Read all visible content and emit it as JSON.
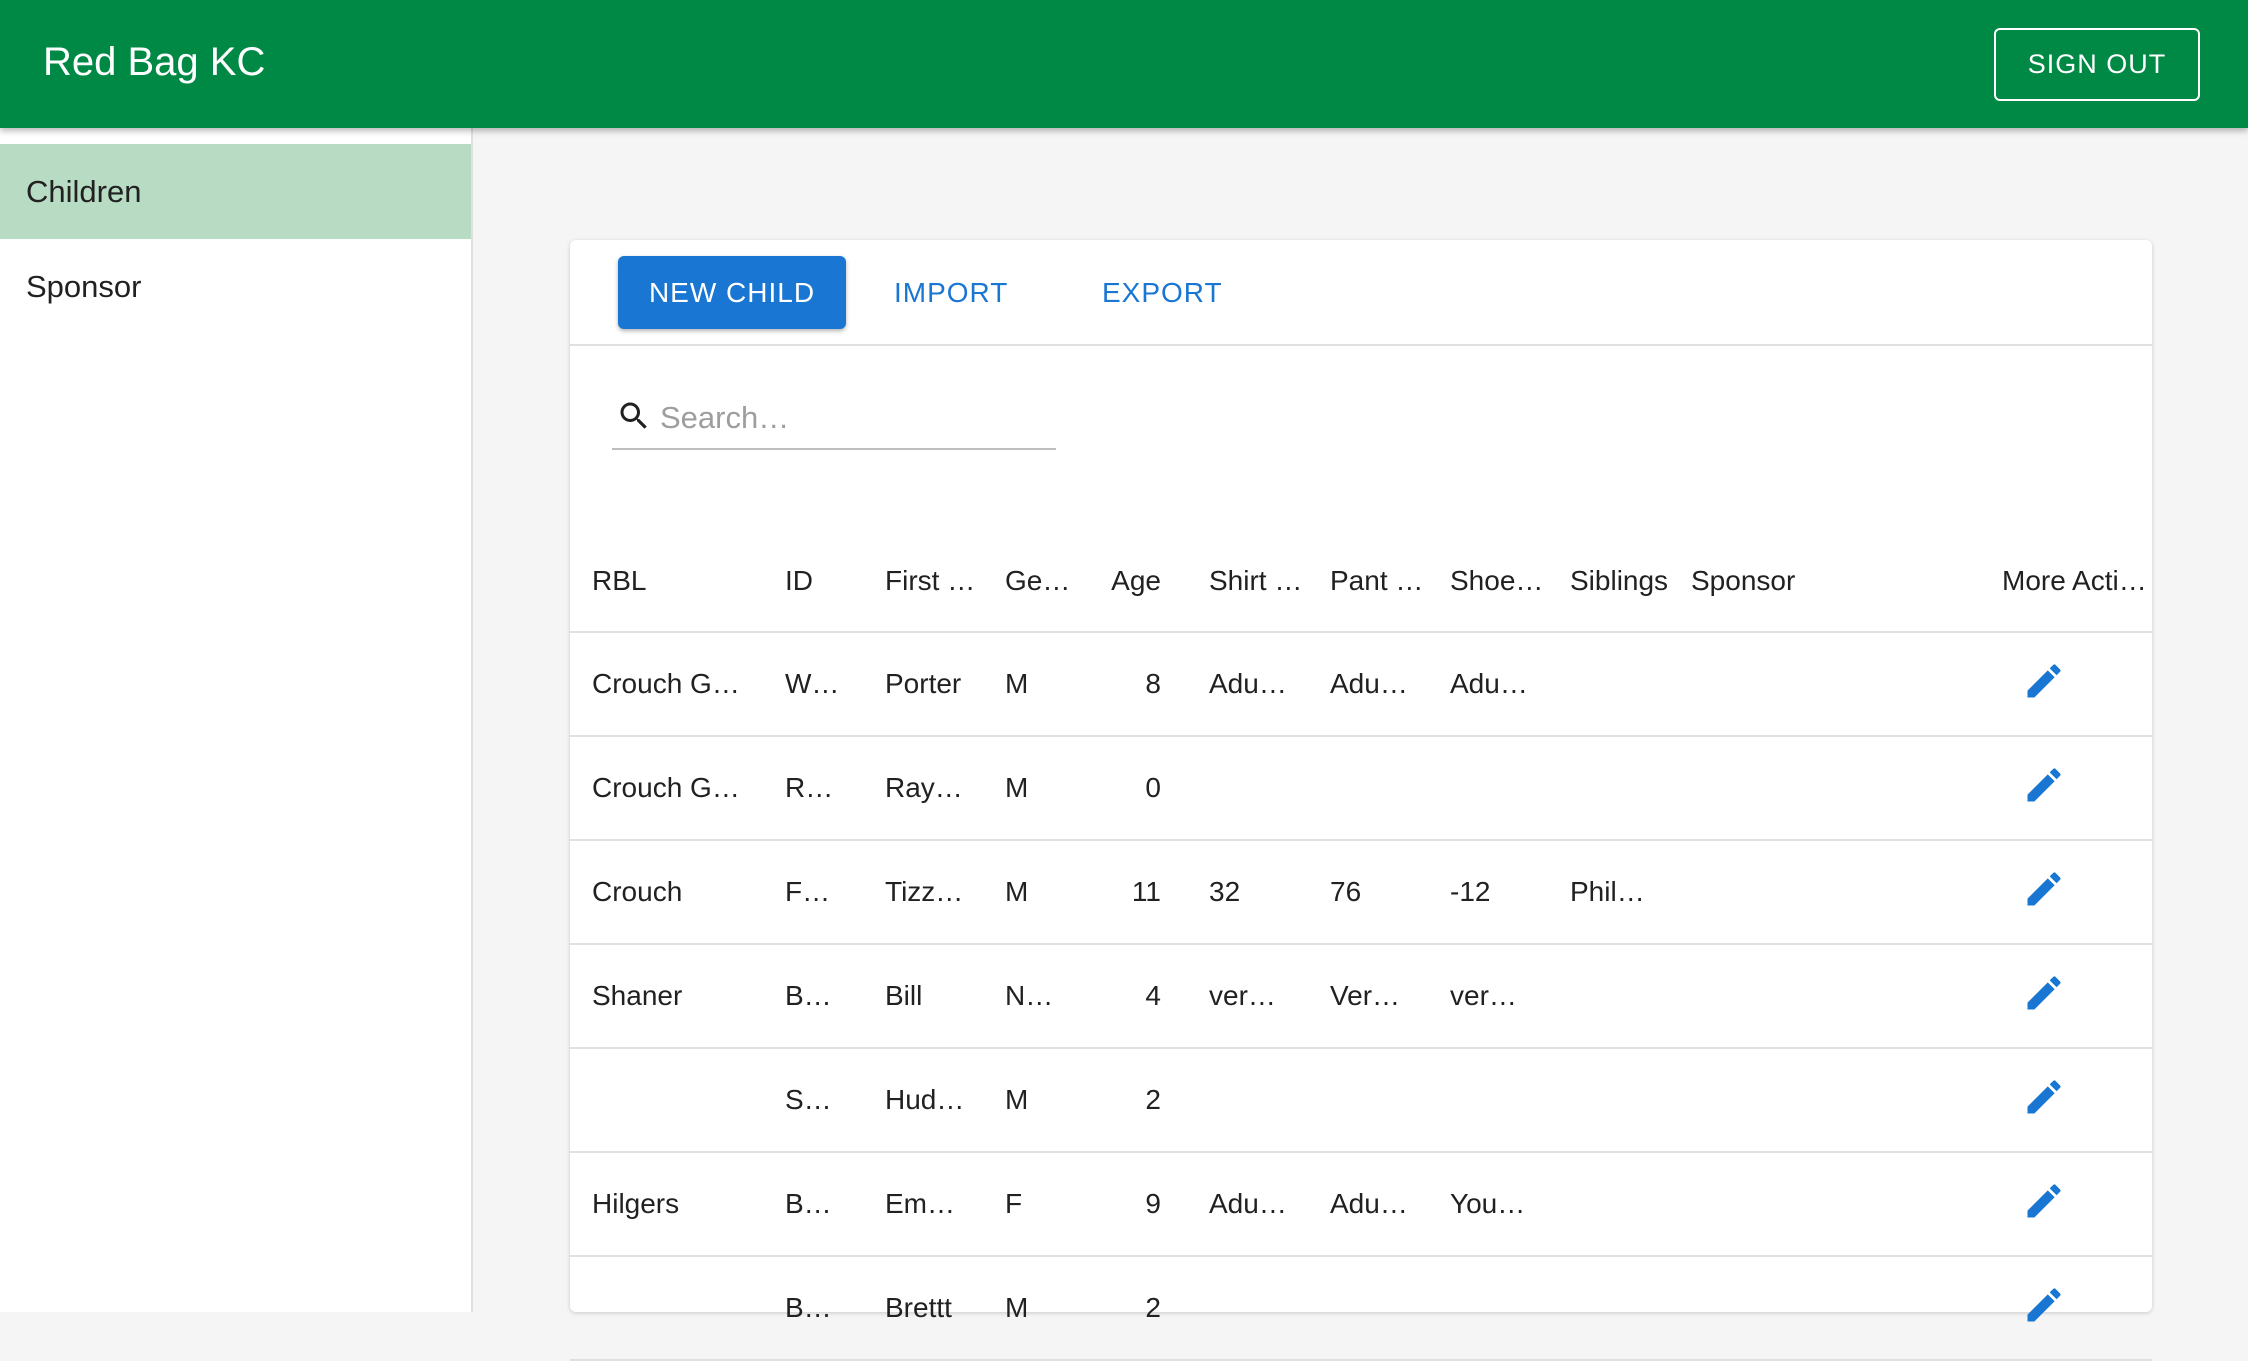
{
  "app": {
    "title": "Red Bag KC",
    "sign_out_label": "SIGN OUT"
  },
  "sidebar": {
    "items": [
      {
        "label": "Children"
      },
      {
        "label": "Sponsor"
      }
    ]
  },
  "toolbar": {
    "new_child_label": "NEW CHILD",
    "import_label": "IMPORT",
    "export_label": "EXPORT"
  },
  "search": {
    "placeholder": "Search…",
    "value": ""
  },
  "table": {
    "headers": [
      "RBL",
      "ID",
      "First …",
      "Ge…",
      "Age",
      "Shirt …",
      "Pant …",
      "Shoe…",
      "Siblings",
      "Sponsor",
      "More Acti…"
    ],
    "rows": [
      [
        "Crouch G…",
        "W…",
        "Porter",
        "M",
        "8",
        "Adu…",
        "Adu…",
        "Adu…",
        "",
        ""
      ],
      [
        "Crouch G…",
        "R…",
        "Ray…",
        "M",
        "0",
        "",
        "",
        "",
        "",
        ""
      ],
      [
        "Crouch",
        "F…",
        "Tizz…",
        "M",
        "11",
        "32",
        "76",
        "-12",
        "Phil…",
        ""
      ],
      [
        "Shaner",
        "B…",
        "Bill",
        "N…",
        "4",
        "ver…",
        "Ver…",
        "ver…",
        "",
        ""
      ],
      [
        "",
        "S…",
        "Hud…",
        "M",
        "2",
        "",
        "",
        "",
        "",
        ""
      ],
      [
        "Hilgers",
        "B…",
        "Em…",
        "F",
        "9",
        "Adu…",
        "Adu…",
        "You…",
        "",
        ""
      ],
      [
        "",
        "B…",
        "Brettt",
        "M",
        "2",
        "",
        "",
        "",
        "",
        ""
      ]
    ]
  },
  "colors": {
    "appbar": "#008945",
    "primary": "#1976d2",
    "nav_active": "#b7dbc3"
  },
  "icons": {
    "search": "search-icon",
    "edit": "pencil-icon"
  }
}
